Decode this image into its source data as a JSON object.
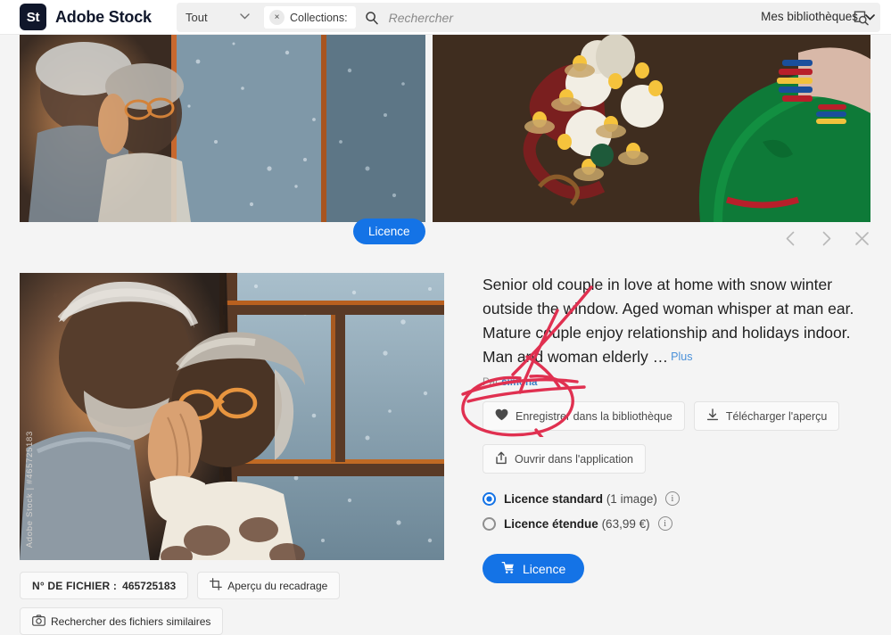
{
  "header": {
    "brand_mark": "St",
    "brand_name": "Adobe Stock",
    "scope_label": "Tout",
    "scope_chevron": "chevron-down-icon",
    "collection_chip": "Collections:",
    "chip_close": "×",
    "search_placeholder": "Rechercher",
    "search_value": "",
    "search_icon": "search-icon",
    "visual_search_icon": "visual-search-icon",
    "libraries_label": "Mes bibliothèques",
    "libraries_chevron": "chevron-down-icon"
  },
  "strip": {
    "licence_overlay_label": "Licence",
    "thumb_a_alt": "senior-couple-window-thumbnail",
    "thumb_b_alt": "diwali-rangoli-green-saree-thumbnail"
  },
  "nav": {
    "prev": "‹",
    "next": "›",
    "close": "✕"
  },
  "hero": {
    "watermark": "Adobe Stock | #465725183",
    "alt": "senior-couple-in-love-at-window"
  },
  "detail": {
    "description": "Senior old couple in love at home with snow winter outside the window. Aged woman whisper at man ear. Mature couple enjoy relationship and holidays indoor. Man and woman elderly …",
    "more_label": "Plus",
    "by_prefix": "Par",
    "author": "simona",
    "buttons": [
      {
        "label": "Enregistrer dans la bibliothèque",
        "icon": "heart-icon"
      },
      {
        "label": "Télécharger l'aperçu",
        "icon": "download-icon"
      },
      {
        "label": "Ouvrir dans l'application",
        "icon": "open-in-app-icon"
      }
    ],
    "licenses": [
      {
        "name": "Licence standard",
        "detail": "(1 image)",
        "selected": true
      },
      {
        "name": "Licence étendue",
        "detail": "(63,99 €)",
        "selected": false
      }
    ],
    "buy_label": "Licence",
    "buy_icon": "cart-icon"
  },
  "bottom": {
    "file_label": "N° DE FICHIER :",
    "file_value": "465725183",
    "crop_label": "Aperçu du recadrage",
    "crop_icon": "crop-icon",
    "similar_label": "Rechercher des fichiers similaires",
    "similar_icon": "camera-icon"
  },
  "colors": {
    "accent": "#1473e6",
    "brand_dark": "#10172b",
    "page_bg": "#f4f4f4",
    "annotation": "#e03050",
    "link": "#3a7fc4"
  }
}
